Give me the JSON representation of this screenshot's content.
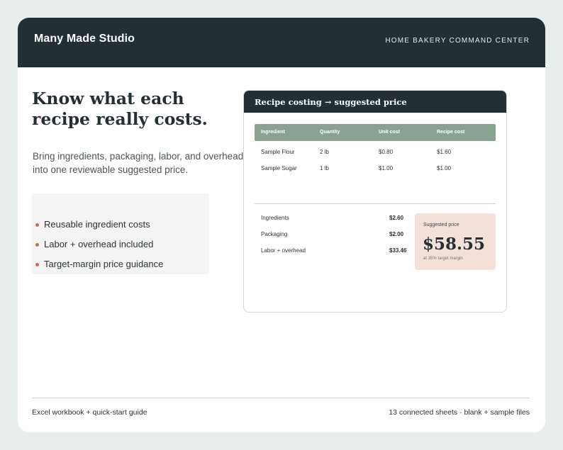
{
  "header": {
    "brand": "Many Made Studio",
    "tagline": "HOME BAKERY COMMAND CENTER"
  },
  "hero": {
    "headline": "Know what each recipe really costs.",
    "subtitle": "Bring ingredients, packaging, labor, and overhead into one reviewable suggested price."
  },
  "features": [
    "Reusable ingredient costs",
    "Labor + overhead included",
    "Target-margin price guidance"
  ],
  "panel": {
    "title": "Recipe costing → suggested price",
    "columns": [
      "Ingredient",
      "Quantity",
      "Unit cost",
      "Recipe cost"
    ],
    "rows": [
      [
        "Sample Flour",
        "2 lb",
        "$0.80",
        "$1.60"
      ],
      [
        "Sample Sugar",
        "1 lb",
        "$1.00",
        "$1.00"
      ]
    ],
    "summary": [
      {
        "label": "Ingredients",
        "value": "$2.60"
      },
      {
        "label": "Packaging",
        "value": "$2.00"
      },
      {
        "label": "Labor + overhead",
        "value": "$33.46"
      }
    ],
    "price": {
      "label": "Suggested price",
      "value": "$58.55",
      "note": "at 35% target margin"
    }
  },
  "footer": {
    "left": "Excel workbook + quick-start guide",
    "right": "13 connected sheets · blank + sample files"
  },
  "colors": {
    "dark": "#223035",
    "accent_green": "#8aa391",
    "accent_peach": "#f3e0d8",
    "bullet": "#c4714e",
    "background": "#e7eeeb"
  }
}
